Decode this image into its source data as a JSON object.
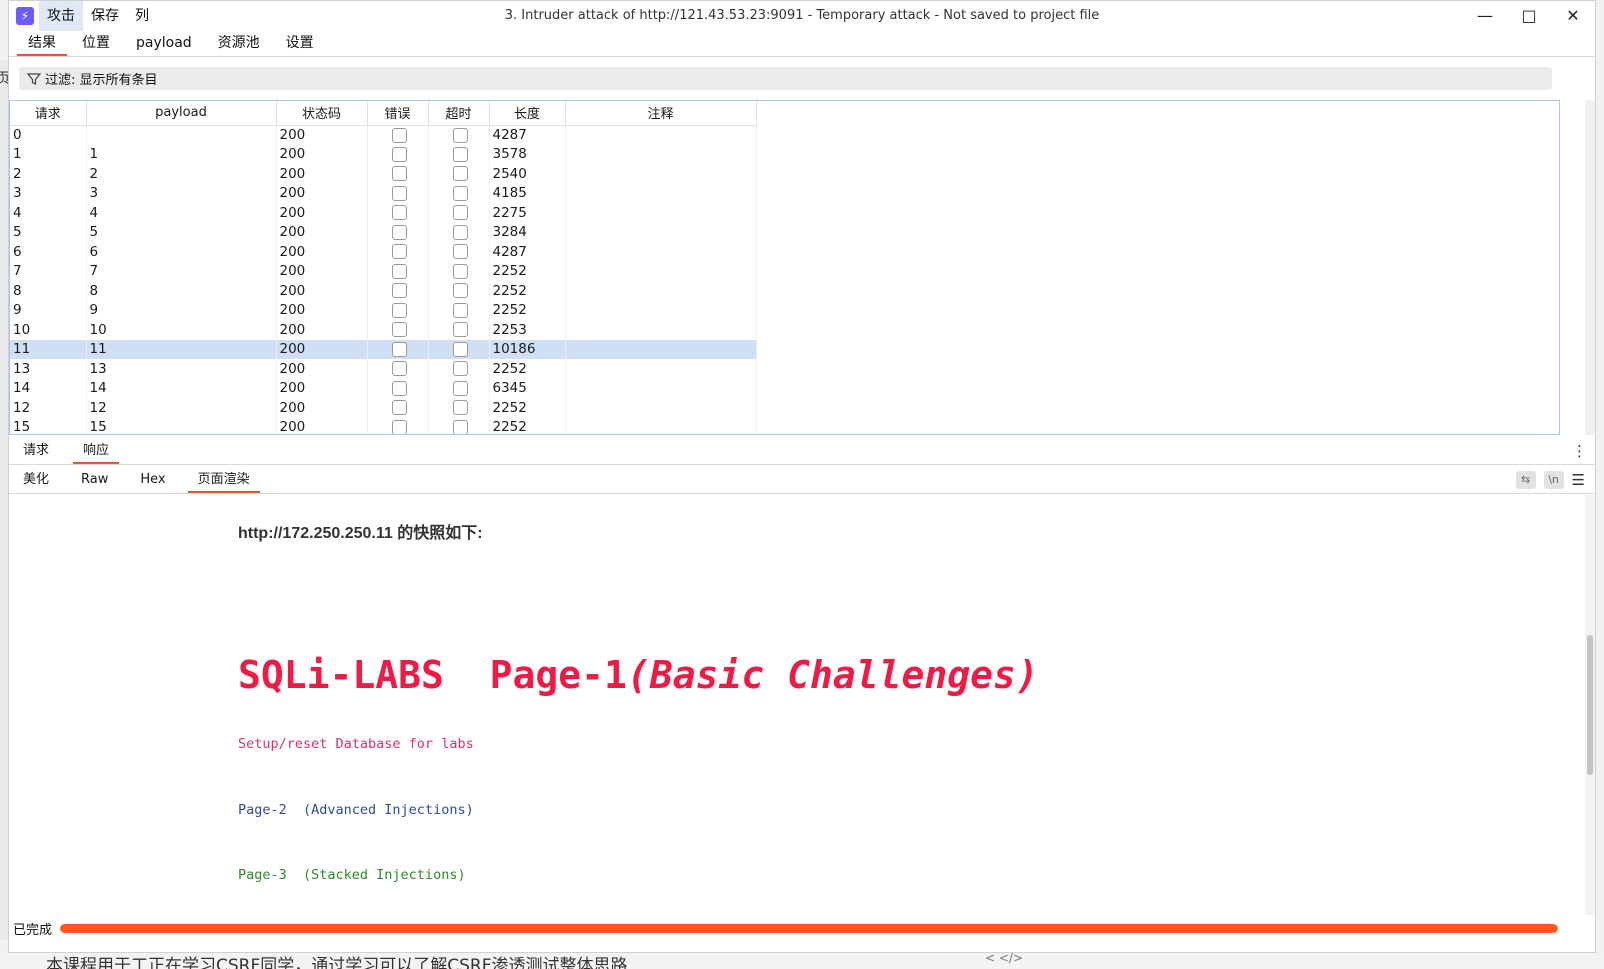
{
  "background": {
    "left_char": "页",
    "bottom_text": "本课程用于工正在学习CSRF同学，通过学习可以了解CSRF渗透测试整体思路",
    "bottom_icon": "< </>"
  },
  "titlebar": {
    "menu": [
      "攻击",
      "保存",
      "列"
    ],
    "title": "3. Intruder attack of http://121.43.53.23:9091 - Temporary attack - Not saved to project file"
  },
  "tabs": [
    "结果",
    "位置",
    "payload",
    "资源池",
    "设置"
  ],
  "filter": {
    "label": "过滤: 显示所有条目"
  },
  "table": {
    "columns": [
      "请求",
      "payload",
      "状态码",
      "错误",
      "超时",
      "长度",
      "注释"
    ],
    "rows": [
      {
        "req": "0",
        "payload": "",
        "status": "200",
        "length": "4287",
        "selected": false
      },
      {
        "req": "1",
        "payload": "1",
        "status": "200",
        "length": "3578",
        "selected": false
      },
      {
        "req": "2",
        "payload": "2",
        "status": "200",
        "length": "2540",
        "selected": false
      },
      {
        "req": "3",
        "payload": "3",
        "status": "200",
        "length": "4185",
        "selected": false
      },
      {
        "req": "4",
        "payload": "4",
        "status": "200",
        "length": "2275",
        "selected": false
      },
      {
        "req": "5",
        "payload": "5",
        "status": "200",
        "length": "3284",
        "selected": false
      },
      {
        "req": "6",
        "payload": "6",
        "status": "200",
        "length": "4287",
        "selected": false
      },
      {
        "req": "7",
        "payload": "7",
        "status": "200",
        "length": "2252",
        "selected": false
      },
      {
        "req": "8",
        "payload": "8",
        "status": "200",
        "length": "2252",
        "selected": false
      },
      {
        "req": "9",
        "payload": "9",
        "status": "200",
        "length": "2252",
        "selected": false
      },
      {
        "req": "10",
        "payload": "10",
        "status": "200",
        "length": "2253",
        "selected": false
      },
      {
        "req": "11",
        "payload": "11",
        "status": "200",
        "length": "10186",
        "selected": true
      },
      {
        "req": "13",
        "payload": "13",
        "status": "200",
        "length": "2252",
        "selected": false
      },
      {
        "req": "14",
        "payload": "14",
        "status": "200",
        "length": "6345",
        "selected": false
      },
      {
        "req": "12",
        "payload": "12",
        "status": "200",
        "length": "2252",
        "selected": false
      },
      {
        "req": "15",
        "payload": "15",
        "status": "200",
        "length": "2252",
        "selected": false
      }
    ]
  },
  "rr_tabs": [
    "请求",
    "响应"
  ],
  "sub_tabs": [
    "美化",
    "Raw",
    "Hex",
    "页面渲染"
  ],
  "sub_icons": [
    "wrap-icon",
    "newline-icon",
    "menu-icon"
  ],
  "newline_label": "\\n",
  "render": {
    "snapshot": "http://172.250.250.11 的快照如下:",
    "title_plain": "SQLi-LABS  Page-1",
    "title_italic": "(Basic Challenges)",
    "setup": "Setup/reset Database for labs",
    "page2": "Page-2  (Advanced Injections)",
    "page3": "Page-3  (Stacked Injections)"
  },
  "status": {
    "text": "已完成",
    "progress": 1.0
  },
  "colors": {
    "accent": "#e8552d",
    "progress": "#ff5a1f",
    "sqli_red": "#f21a45",
    "selected_row": "#cfe0f6"
  }
}
